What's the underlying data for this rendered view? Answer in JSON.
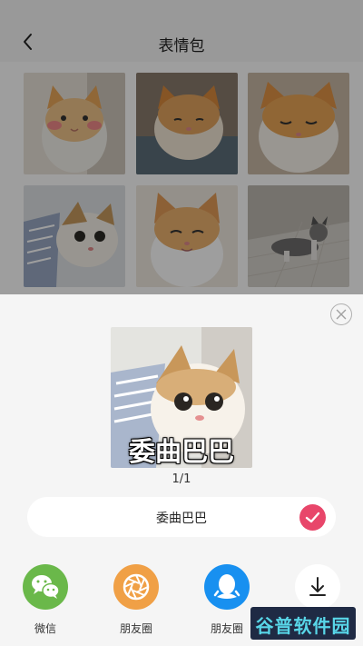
{
  "header": {
    "title": "表情包",
    "back_icon": "chevron-left-icon"
  },
  "grid": {
    "images": [
      {
        "name": "cat-blush"
      },
      {
        "name": "cat-sleepy"
      },
      {
        "name": "cat-tired"
      },
      {
        "name": "cat-wrinkled-cloth"
      },
      {
        "name": "cat-smile"
      },
      {
        "name": "cat-lying-floor"
      }
    ]
  },
  "sheet": {
    "close_icon": "close-icon",
    "preview": {
      "caption": "委曲巴巴"
    },
    "counter": "1/1",
    "caption_field": {
      "value": "委曲巴巴",
      "confirm_icon": "check-icon"
    },
    "share_targets": [
      {
        "label": "微信",
        "icon": "wechat-icon",
        "color": "#6ab84a"
      },
      {
        "label": "朋友圈",
        "icon": "moments-icon",
        "color": "#f0a046"
      },
      {
        "label": "朋友圈",
        "icon": "qq-icon",
        "color": "#1890f0"
      },
      {
        "label": "",
        "icon": "download-icon",
        "color": "#ffffff"
      }
    ]
  },
  "watermark": {
    "text": "谷普软件园"
  },
  "colors": {
    "accent": "#e8466a",
    "overlay": "rgba(0,0,0,0.38)"
  }
}
